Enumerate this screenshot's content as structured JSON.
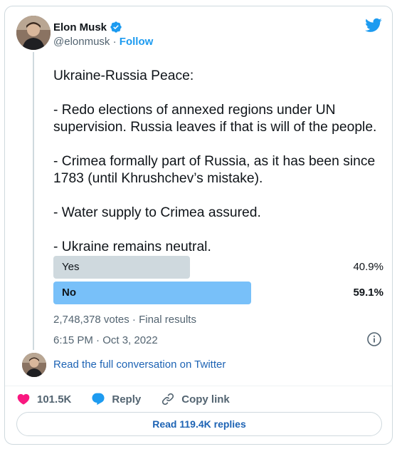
{
  "author": {
    "display_name": "Elon Musk",
    "handle": "@elonmusk",
    "separator": "·",
    "follow_label": "Follow"
  },
  "tweet": {
    "lines": [
      "Ukraine-Russia Peace:",
      "- Redo elections of annexed regions under UN supervision. Russia leaves if that is will of the people.",
      "- Crimea formally part of Russia, as it has been since 1783 (until Khrushchev’s mistake).",
      "- Water supply to Crimea assured.",
      "- Ukraine remains neutral."
    ]
  },
  "poll": {
    "options": [
      {
        "label": "Yes",
        "percent_text": "40.9%",
        "percent": 40.9,
        "winner": false,
        "bar_color": "#cfd9de"
      },
      {
        "label": "No",
        "percent_text": "59.1%",
        "percent": 59.1,
        "winner": true,
        "bar_color": "#78c0f9"
      }
    ],
    "summary": "2,748,378 votes · Final results"
  },
  "timestamp": "6:15 PM · Oct 3, 2022",
  "conversation_link": "Read the full conversation on Twitter",
  "actions": {
    "like_count": "101.5K",
    "reply_label": "Reply",
    "copy_link_label": "Copy link"
  },
  "read_replies_label": "Read 119.4K replies",
  "colors": {
    "brand_blue": "#1d9bf0",
    "link_blue": "#1d63b4",
    "like_red": "#f91880",
    "muted_text": "#536471"
  },
  "icons": [
    "verified-badge-icon",
    "twitter-bird-icon",
    "info-icon",
    "heart-icon",
    "reply-bubble-icon",
    "link-icon"
  ]
}
